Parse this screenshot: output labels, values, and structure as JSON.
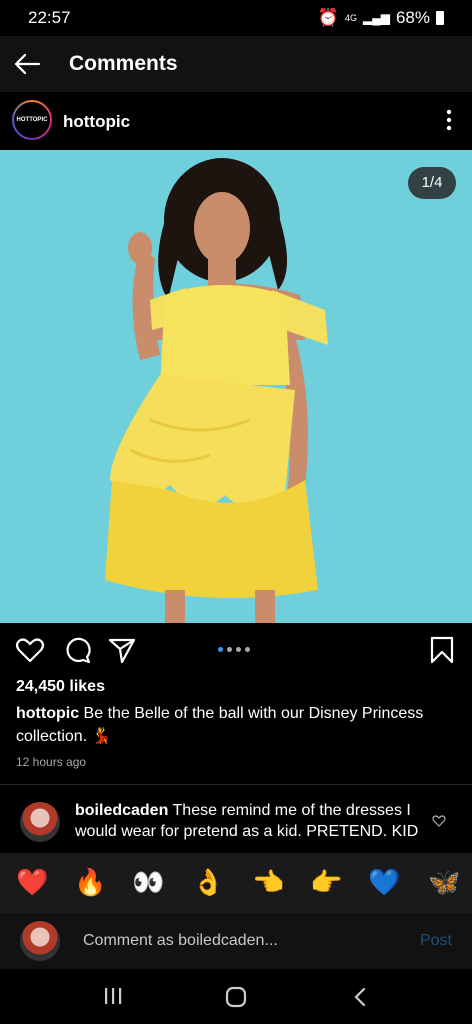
{
  "status_bar": {
    "time": "22:57",
    "network": "4G",
    "battery": "68%"
  },
  "header": {
    "title": "Comments"
  },
  "post": {
    "author": "hottopic",
    "avatar_text": "HOTTOPIC",
    "image_counter": "1/4",
    "likes": "24,450 likes",
    "caption_user": "hottopic",
    "caption_text": "Be the Belle of the ball with our Disney Princess collection. 💃",
    "time_ago": "12 hours ago",
    "carousel_index": 1,
    "carousel_total": 4
  },
  "comment": {
    "user": "boiledcaden",
    "text": "These remind me of the dresses I would wear for pretend as a kid. PRETEND. KID"
  },
  "reactions": [
    "❤️",
    "🔥",
    "👀",
    "👌",
    "👈",
    "👉",
    "💙",
    "🦋"
  ],
  "input": {
    "placeholder": "Comment as boiledcaden...",
    "post_label": "Post"
  },
  "colors": {
    "accent": "#3897f0",
    "photo_bg": "#6fd0dc",
    "dress": "#f7e25b"
  }
}
